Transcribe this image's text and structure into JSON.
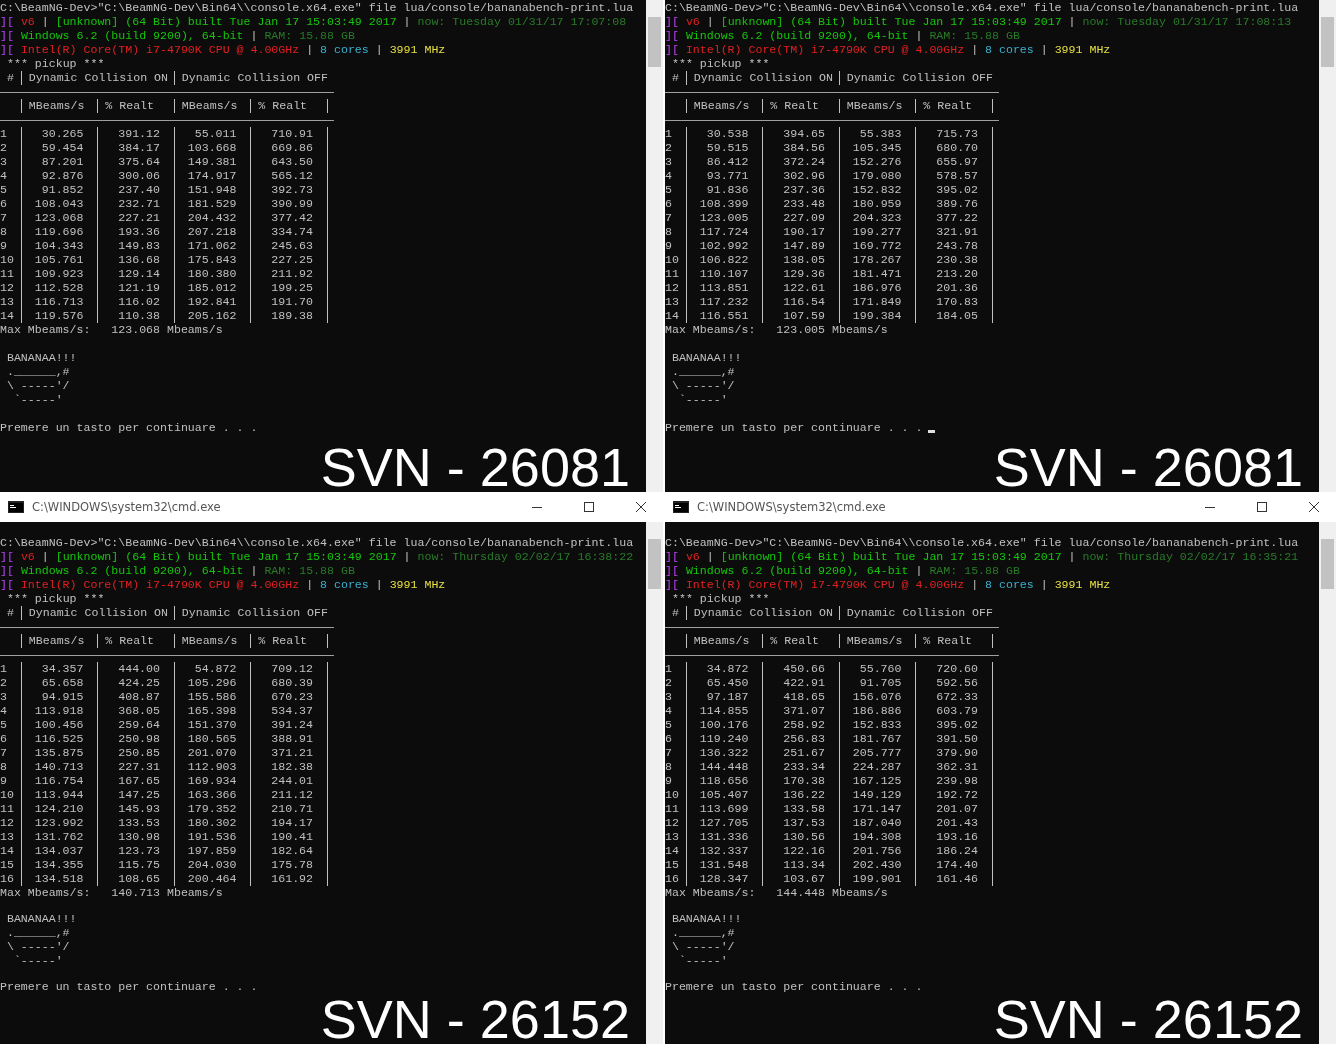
{
  "panels": [
    {
      "command": "C:\\BeamNG-Dev>\"C:\\BeamNG-Dev\\Bin64\\\\console.x64.exe\" file lua/console/bananabench-print.lua",
      "info_lines": [
        [
          {
            "text": "][",
            "kind": "marker"
          },
          {
            "text": " v6",
            "kind": "alert"
          },
          {
            "text": " | ",
            "kind": "plain"
          },
          {
            "text": "[unknown] (64 Bit) built Tue Jan 17 15:03:49 2017",
            "kind": "ok"
          },
          {
            "text": " | ",
            "kind": "plain"
          },
          {
            "text": "now: Tuesday 01/31/17 17:07:08",
            "kind": "muted"
          }
        ],
        [
          {
            "text": "][",
            "kind": "marker"
          },
          {
            "text": " Windows 6.2 (build 9200), 64-bit",
            "kind": "ok"
          },
          {
            "text": " | ",
            "kind": "plain"
          },
          {
            "text": "RAM: 15.88 GB",
            "kind": "muted"
          }
        ],
        [
          {
            "text": "][",
            "kind": "marker"
          },
          {
            "text": " Intel(R) Core(TM) i7-4790K CPU @ 4.00GHz",
            "kind": "alert"
          },
          {
            "text": " | ",
            "kind": "plain"
          },
          {
            "text": "8 cores",
            "kind": "info"
          },
          {
            "text": " | ",
            "kind": "plain"
          },
          {
            "text": "3991 MHz",
            "kind": "warn"
          }
        ]
      ],
      "section": "*** pickup ***",
      "table": {
        "corner": "#",
        "groups": [
          "Dynamic Collision ON",
          "Dynamic Collision OFF"
        ],
        "columns": [
          "MBeams/s",
          "% Realt",
          "MBeams/s",
          "% Realt"
        ],
        "rows": [
          {
            "index": "1",
            "cells": [
              "30.265",
              "391.12",
              "55.011",
              "710.91"
            ]
          },
          {
            "index": "2",
            "cells": [
              "59.454",
              "384.17",
              "103.668",
              "669.86"
            ]
          },
          {
            "index": "3",
            "cells": [
              "87.201",
              "375.64",
              "149.381",
              "643.50"
            ]
          },
          {
            "index": "4",
            "cells": [
              "92.876",
              "300.06",
              "174.917",
              "565.12"
            ]
          },
          {
            "index": "5",
            "cells": [
              "91.852",
              "237.40",
              "151.948",
              "392.73"
            ]
          },
          {
            "index": "6",
            "cells": [
              "108.043",
              "232.71",
              "181.529",
              "390.99"
            ]
          },
          {
            "index": "7",
            "cells": [
              "123.068",
              "227.21",
              "204.432",
              "377.42"
            ]
          },
          {
            "index": "8",
            "cells": [
              "119.696",
              "193.36",
              "207.218",
              "334.74"
            ]
          },
          {
            "index": "9",
            "cells": [
              "104.343",
              "149.83",
              "171.062",
              "245.63"
            ]
          },
          {
            "index": "10",
            "cells": [
              "105.761",
              "136.68",
              "175.843",
              "227.25"
            ]
          },
          {
            "index": "11",
            "cells": [
              "109.923",
              "129.14",
              "180.380",
              "211.92"
            ]
          },
          {
            "index": "12",
            "cells": [
              "112.528",
              "121.19",
              "185.012",
              "199.25"
            ]
          },
          {
            "index": "13",
            "cells": [
              "116.713",
              "116.02",
              "192.841",
              "191.70"
            ]
          },
          {
            "index": "14",
            "cells": [
              "119.576",
              "110.38",
              "205.162",
              "189.38"
            ]
          }
        ]
      },
      "summary": "Max Mbeams/s:   123.068 Mbeams/s",
      "art": [
        " BANANAA!!!",
        " .______,#",
        " \\ -----'/",
        "  `-----'"
      ],
      "prompt": "Premere un tasto per continuare . . .",
      "cursor": false,
      "label": "SVN - 26081"
    },
    {
      "command": "C:\\BeamNG-Dev>\"C:\\BeamNG-Dev\\Bin64\\\\console.x64.exe\" file lua/console/bananabench-print.lua",
      "info_lines": [
        [
          {
            "text": "][",
            "kind": "marker"
          },
          {
            "text": " v6",
            "kind": "alert"
          },
          {
            "text": " | ",
            "kind": "plain"
          },
          {
            "text": "[unknown] (64 Bit) built Tue Jan 17 15:03:49 2017",
            "kind": "ok"
          },
          {
            "text": " | ",
            "kind": "plain"
          },
          {
            "text": "now: Tuesday 01/31/17 17:08:13",
            "kind": "muted"
          }
        ],
        [
          {
            "text": "][",
            "kind": "marker"
          },
          {
            "text": " Windows 6.2 (build 9200), 64-bit",
            "kind": "ok"
          },
          {
            "text": " | ",
            "kind": "plain"
          },
          {
            "text": "RAM: 15.88 GB",
            "kind": "muted"
          }
        ],
        [
          {
            "text": "][",
            "kind": "marker"
          },
          {
            "text": " Intel(R) Core(TM) i7-4790K CPU @ 4.00GHz",
            "kind": "alert"
          },
          {
            "text": " | ",
            "kind": "plain"
          },
          {
            "text": "8 cores",
            "kind": "info"
          },
          {
            "text": " | ",
            "kind": "plain"
          },
          {
            "text": "3991 MHz",
            "kind": "warn"
          }
        ]
      ],
      "section": "*** pickup ***",
      "table": {
        "corner": "#",
        "groups": [
          "Dynamic Collision ON",
          "Dynamic Collision OFF"
        ],
        "columns": [
          "MBeams/s",
          "% Realt",
          "MBeams/s",
          "% Realt"
        ],
        "rows": [
          {
            "index": "1",
            "cells": [
              "30.538",
              "394.65",
              "55.383",
              "715.73"
            ]
          },
          {
            "index": "2",
            "cells": [
              "59.515",
              "384.56",
              "105.345",
              "680.70"
            ]
          },
          {
            "index": "3",
            "cells": [
              "86.412",
              "372.24",
              "152.276",
              "655.97"
            ]
          },
          {
            "index": "4",
            "cells": [
              "93.771",
              "302.96",
              "179.080",
              "578.57"
            ]
          },
          {
            "index": "5",
            "cells": [
              "91.836",
              "237.36",
              "152.832",
              "395.02"
            ]
          },
          {
            "index": "6",
            "cells": [
              "108.399",
              "233.48",
              "180.959",
              "389.76"
            ]
          },
          {
            "index": "7",
            "cells": [
              "123.005",
              "227.09",
              "204.323",
              "377.22"
            ]
          },
          {
            "index": "8",
            "cells": [
              "117.724",
              "190.17",
              "199.277",
              "321.91"
            ]
          },
          {
            "index": "9",
            "cells": [
              "102.992",
              "147.89",
              "169.772",
              "243.78"
            ]
          },
          {
            "index": "10",
            "cells": [
              "106.822",
              "138.05",
              "178.267",
              "230.38"
            ]
          },
          {
            "index": "11",
            "cells": [
              "110.107",
              "129.36",
              "181.471",
              "213.20"
            ]
          },
          {
            "index": "12",
            "cells": [
              "113.851",
              "122.61",
              "186.976",
              "201.36"
            ]
          },
          {
            "index": "13",
            "cells": [
              "117.232",
              "116.54",
              "171.849",
              "170.83"
            ]
          },
          {
            "index": "14",
            "cells": [
              "116.551",
              "107.59",
              "199.384",
              "184.05"
            ]
          }
        ]
      },
      "summary": "Max Mbeams/s:   123.005 Mbeams/s",
      "art": [
        " BANANAA!!!",
        " .______,#",
        " \\ -----'/",
        "  `-----'"
      ],
      "prompt": "Premere un tasto per continuare . . .",
      "cursor": true,
      "label": "SVN - 26081"
    },
    {
      "title_bar": {
        "title": "C:\\WINDOWS\\system32\\cmd.exe"
      },
      "command": "C:\\BeamNG-Dev>\"C:\\BeamNG-Dev\\Bin64\\\\console.x64.exe\" file lua/console/bananabench-print.lua",
      "info_lines": [
        [
          {
            "text": "][",
            "kind": "marker"
          },
          {
            "text": " v6",
            "kind": "alert"
          },
          {
            "text": " | ",
            "kind": "plain"
          },
          {
            "text": "[unknown] (64 Bit) built Tue Jan 17 15:03:49 2017",
            "kind": "ok"
          },
          {
            "text": " | ",
            "kind": "plain"
          },
          {
            "text": "now: Thursday 02/02/17 16:38:22",
            "kind": "muted"
          }
        ],
        [
          {
            "text": "][",
            "kind": "marker"
          },
          {
            "text": " Windows 6.2 (build 9200), 64-bit",
            "kind": "ok"
          },
          {
            "text": " | ",
            "kind": "plain"
          },
          {
            "text": "RAM: 15.88 GB",
            "kind": "muted"
          }
        ],
        [
          {
            "text": "][",
            "kind": "marker"
          },
          {
            "text": " Intel(R) Core(TM) i7-4790K CPU @ 4.00GHz",
            "kind": "alert"
          },
          {
            "text": " | ",
            "kind": "plain"
          },
          {
            "text": "8 cores",
            "kind": "info"
          },
          {
            "text": " | ",
            "kind": "plain"
          },
          {
            "text": "3991 MHz",
            "kind": "warn"
          }
        ]
      ],
      "section": "*** pickup ***",
      "table": {
        "corner": "#",
        "groups": [
          "Dynamic Collision ON",
          "Dynamic Collision OFF"
        ],
        "columns": [
          "MBeams/s",
          "% Realt",
          "MBeams/s",
          "% Realt"
        ],
        "rows": [
          {
            "index": "1",
            "cells": [
              "34.357",
              "444.00",
              "54.872",
              "709.12"
            ]
          },
          {
            "index": "2",
            "cells": [
              "65.658",
              "424.25",
              "105.296",
              "680.39"
            ]
          },
          {
            "index": "3",
            "cells": [
              "94.915",
              "408.87",
              "155.586",
              "670.23"
            ]
          },
          {
            "index": "4",
            "cells": [
              "113.918",
              "368.05",
              "165.398",
              "534.37"
            ]
          },
          {
            "index": "5",
            "cells": [
              "100.456",
              "259.64",
              "151.370",
              "391.24"
            ]
          },
          {
            "index": "6",
            "cells": [
              "116.525",
              "250.98",
              "180.565",
              "388.91"
            ]
          },
          {
            "index": "7",
            "cells": [
              "135.875",
              "250.85",
              "201.070",
              "371.21"
            ]
          },
          {
            "index": "8",
            "cells": [
              "140.713",
              "227.31",
              "112.903",
              "182.38"
            ]
          },
          {
            "index": "9",
            "cells": [
              "116.754",
              "167.65",
              "169.934",
              "244.01"
            ]
          },
          {
            "index": "10",
            "cells": [
              "113.944",
              "147.25",
              "163.366",
              "211.12"
            ]
          },
          {
            "index": "11",
            "cells": [
              "124.210",
              "145.93",
              "179.352",
              "210.71"
            ]
          },
          {
            "index": "12",
            "cells": [
              "123.992",
              "133.53",
              "180.302",
              "194.17"
            ]
          },
          {
            "index": "13",
            "cells": [
              "131.762",
              "130.98",
              "191.536",
              "190.41"
            ]
          },
          {
            "index": "14",
            "cells": [
              "134.037",
              "123.73",
              "197.859",
              "182.64"
            ]
          },
          {
            "index": "15",
            "cells": [
              "134.355",
              "115.75",
              "204.030",
              "175.78"
            ]
          },
          {
            "index": "16",
            "cells": [
              "134.518",
              "108.65",
              "200.464",
              "161.92"
            ]
          }
        ]
      },
      "summary": "Max Mbeams/s:   140.713 Mbeams/s",
      "art": [
        " BANANAA!!!",
        " .______,#",
        " \\ -----'/",
        "  `-----'"
      ],
      "prompt": "Premere un tasto per continuare . . .",
      "cursor": false,
      "label": "SVN - 26152"
    },
    {
      "title_bar": {
        "title": "C:\\WINDOWS\\system32\\cmd.exe"
      },
      "command": "C:\\BeamNG-Dev>\"C:\\BeamNG-Dev\\Bin64\\\\console.x64.exe\" file lua/console/bananabench-print.lua",
      "info_lines": [
        [
          {
            "text": "][",
            "kind": "marker"
          },
          {
            "text": " v6",
            "kind": "alert"
          },
          {
            "text": " | ",
            "kind": "plain"
          },
          {
            "text": "[unknown] (64 Bit) built Tue Jan 17 15:03:49 2017",
            "kind": "ok"
          },
          {
            "text": " | ",
            "kind": "plain"
          },
          {
            "text": "now: Thursday 02/02/17 16:35:21",
            "kind": "muted"
          }
        ],
        [
          {
            "text": "][",
            "kind": "marker"
          },
          {
            "text": " Windows 6.2 (build 9200), 64-bit",
            "kind": "ok"
          },
          {
            "text": " | ",
            "kind": "plain"
          },
          {
            "text": "RAM: 15.88 GB",
            "kind": "muted"
          }
        ],
        [
          {
            "text": "][",
            "kind": "marker"
          },
          {
            "text": " Intel(R) Core(TM) i7-4790K CPU @ 4.00GHz",
            "kind": "alert"
          },
          {
            "text": " | ",
            "kind": "plain"
          },
          {
            "text": "8 cores",
            "kind": "info"
          },
          {
            "text": " | ",
            "kind": "plain"
          },
          {
            "text": "3991 MHz",
            "kind": "warn"
          }
        ]
      ],
      "section": "*** pickup ***",
      "table": {
        "corner": "#",
        "groups": [
          "Dynamic Collision ON",
          "Dynamic Collision OFF"
        ],
        "columns": [
          "MBeams/s",
          "% Realt",
          "MBeams/s",
          "% Realt"
        ],
        "rows": [
          {
            "index": "1",
            "cells": [
              "34.872",
              "450.66",
              "55.760",
              "720.60"
            ]
          },
          {
            "index": "2",
            "cells": [
              "65.450",
              "422.91",
              "91.705",
              "592.56"
            ]
          },
          {
            "index": "3",
            "cells": [
              "97.187",
              "418.65",
              "156.076",
              "672.33"
            ]
          },
          {
            "index": "4",
            "cells": [
              "114.855",
              "371.07",
              "186.886",
              "603.79"
            ]
          },
          {
            "index": "5",
            "cells": [
              "100.176",
              "258.92",
              "152.833",
              "395.02"
            ]
          },
          {
            "index": "6",
            "cells": [
              "119.240",
              "256.83",
              "181.767",
              "391.50"
            ]
          },
          {
            "index": "7",
            "cells": [
              "136.322",
              "251.67",
              "205.777",
              "379.90"
            ]
          },
          {
            "index": "8",
            "cells": [
              "144.448",
              "233.34",
              "224.287",
              "362.31"
            ]
          },
          {
            "index": "9",
            "cells": [
              "118.656",
              "170.38",
              "167.125",
              "239.98"
            ]
          },
          {
            "index": "10",
            "cells": [
              "105.407",
              "136.22",
              "149.129",
              "192.72"
            ]
          },
          {
            "index": "11",
            "cells": [
              "113.699",
              "133.58",
              "171.147",
              "201.07"
            ]
          },
          {
            "index": "12",
            "cells": [
              "127.705",
              "137.53",
              "187.040",
              "201.43"
            ]
          },
          {
            "index": "13",
            "cells": [
              "131.336",
              "130.56",
              "194.308",
              "193.16"
            ]
          },
          {
            "index": "14",
            "cells": [
              "132.337",
              "122.16",
              "201.756",
              "186.24"
            ]
          },
          {
            "index": "15",
            "cells": [
              "131.548",
              "113.34",
              "202.430",
              "174.40"
            ]
          },
          {
            "index": "16",
            "cells": [
              "128.347",
              "103.67",
              "199.901",
              "161.46"
            ]
          }
        ]
      },
      "summary": "Max Mbeams/s:   144.448 Mbeams/s",
      "art": [
        " BANANAA!!!",
        " .______,#",
        " \\ -----'/",
        "  `-----'"
      ],
      "prompt": "Premere un tasto per continuare . . .",
      "cursor": false,
      "label": "SVN - 26152"
    }
  ]
}
